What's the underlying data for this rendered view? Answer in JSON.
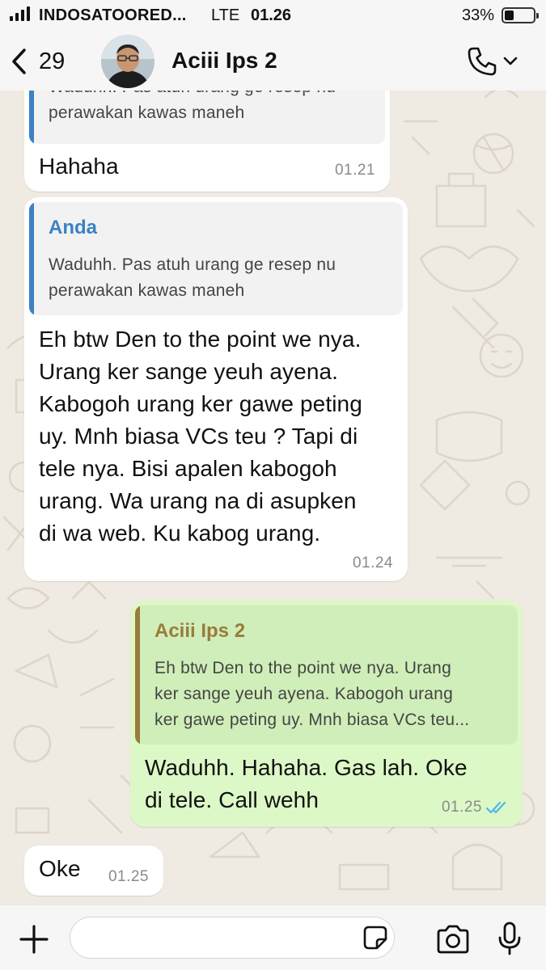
{
  "status_bar": {
    "carrier": "INDOSATOORED...",
    "network": "LTE",
    "time": "01.26",
    "battery_percent": "33%",
    "battery_level": 0.33
  },
  "header": {
    "back_count": "29",
    "contact_name": "Aciii Ips 2",
    "back_icon": "chevron-left-icon",
    "call_icon": "phone-icon"
  },
  "messages": [
    {
      "direction": "incoming",
      "quote": {
        "author": "",
        "text_lines": [
          "Waduhh. Pas atuh urang ge resep nu",
          "perawakan kawas maneh"
        ]
      },
      "text": "Hahaha",
      "time": "01.21"
    },
    {
      "direction": "incoming",
      "quote": {
        "author": "Anda",
        "text_lines": [
          "Waduhh. Pas atuh urang ge resep nu",
          "perawakan kawas maneh"
        ]
      },
      "text_lines": [
        "Eh btw Den to the point we nya.",
        "Urang ker sange yeuh ayena.",
        "Kabogoh urang ker gawe peting",
        "uy. Mnh biasa VCs teu ? Tapi di",
        "tele nya. Bisi apalen kabogoh",
        "urang. Wa urang na di asupken",
        "di wa web. Ku kabog urang."
      ],
      "time": "01.24"
    },
    {
      "direction": "outgoing",
      "quote": {
        "author": "Aciii Ips 2",
        "text_lines": [
          "Eh btw Den to the point we nya. Urang",
          "ker sange yeuh ayena. Kabogoh urang",
          "ker gawe peting uy. Mnh biasa VCs teu..."
        ]
      },
      "text_lines": [
        "Waduhh.  Hahaha. Gas lah. Oke",
        "di tele. Call wehh"
      ],
      "time": "01.25",
      "status": "read"
    },
    {
      "direction": "incoming",
      "text": "Oke",
      "time": "01.25"
    }
  ],
  "input_bar": {
    "placeholder": "",
    "value": "",
    "icons": [
      "plus-icon",
      "sticker-icon",
      "camera-icon",
      "microphone-icon"
    ]
  },
  "colors": {
    "wallpaper": "#efeae2",
    "incoming_bubble": "#ffffff",
    "outgoing_bubble": "#dcf8c6",
    "quote_bar_you": "#3b82c4",
    "quote_bar_contact": "#9a7b3b",
    "read_ticks": "#4fb6ec"
  }
}
